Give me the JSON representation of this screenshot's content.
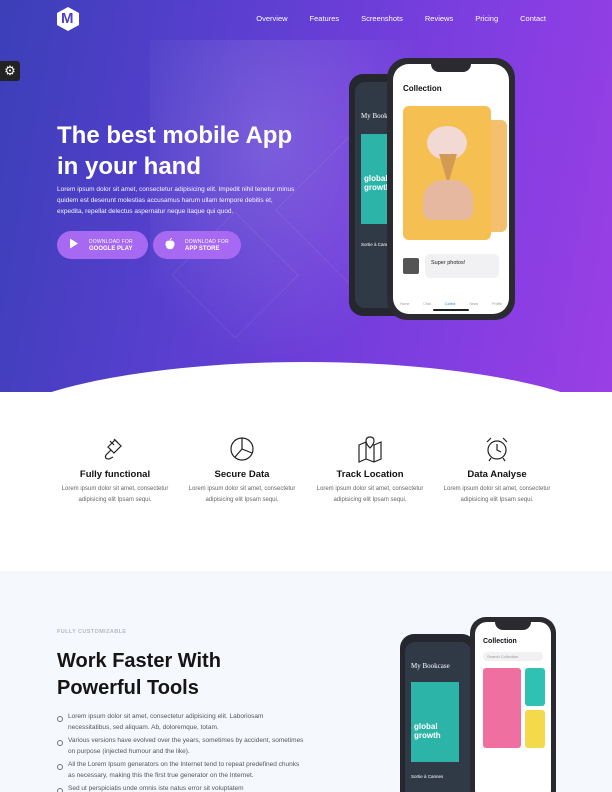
{
  "nav": {
    "items": [
      "Overview",
      "Features",
      "Screenshots",
      "Reviews",
      "Pricing",
      "Contact"
    ]
  },
  "hero": {
    "title": "The best mobile App in your hand",
    "text": "Lorem ipsum dolor sit amet, consectetur adipisicing elit. Impedit nihil tenetur minus quidem est deserunt molestias accusamus harum ullam tempore debitis et, expedita, repellat delectus aspernatur neque itaque qui quod.",
    "buttons": [
      {
        "small": "DOWNLOAD FOR",
        "big": "GOOGLE PLAY",
        "icon": "play-store-icon"
      },
      {
        "small": "DOWNLOAD FOR",
        "big": "APP STORE",
        "icon": "apple-icon"
      }
    ],
    "phone": {
      "screen_title": "Collection",
      "chat_text": "Super photos!",
      "tabs": [
        "Home",
        "Chat",
        "Collect",
        "News",
        "Profile"
      ],
      "back_title": "My Book",
      "back_cover_text": "global growth",
      "back_subtitle": "Sortie à Cannes"
    }
  },
  "features": [
    {
      "title": "Fully functional",
      "text": "Lorem ipsum dolor sit amet, consectetur adipisicing elit Ipsam sequi.",
      "icon": "plug-icon"
    },
    {
      "title": "Secure Data",
      "text": "Lorem ipsum dolor sit amet, consectetur adipisicing elit Ipsam sequi.",
      "icon": "pie-chart-icon"
    },
    {
      "title": "Track Location",
      "text": "Lorem ipsum dolor sit amet, consectetur adipisicing elit Ipsam sequi.",
      "icon": "map-pin-icon"
    },
    {
      "title": "Data Analyse",
      "text": "Lorem ipsum dolor sit amet, consectetur adipisicing elit Ipsam sequi.",
      "icon": "alarm-clock-icon"
    }
  ],
  "section2": {
    "eyebrow": "FULLY CUSTOMIZABLE",
    "title": "Work Faster With Powerful Tools",
    "bullets": [
      "Lorem ipsum dolor sit amet, consectetur adipisicing elit. Laboriosam necessitatibus, sed aliquam. Ab, doloremque, totam.",
      "Various versions have evolved over the years, sometimes by accident, sometimes on purpose (injected humour and the like).",
      "All the Lorem Ipsum generators on the Internet tend to repeat predefined chunks as necessary, making this the first true generator on the Internet.",
      "Sed ut perspiciatis unde omnis iste natus error sit voluptatem"
    ],
    "phone_front_title": "Collection",
    "phone_front_search": "Search Collection",
    "phone_back_title": "My Bookcase",
    "phone_back_cover": "global growth",
    "phone_back_sub": "Sortie à Cannes"
  },
  "colors": {
    "accent": "#7d3ee0",
    "hero_start": "#3b3fb8",
    "hero_end": "#9a3fe6",
    "button": "#a768f2"
  }
}
